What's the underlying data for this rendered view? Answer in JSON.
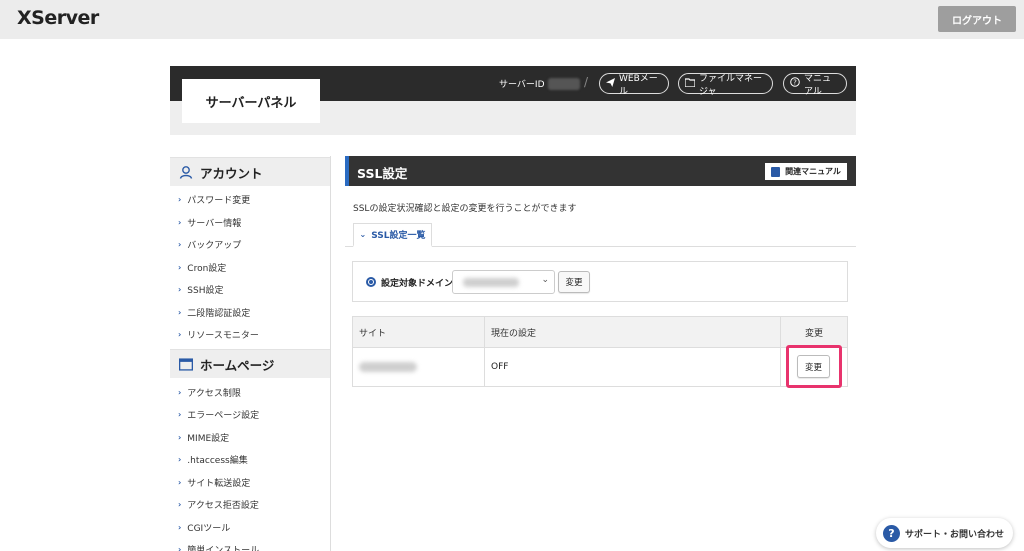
{
  "header": {
    "logo": "XServer",
    "logout_label": "ログアウト"
  },
  "panel": {
    "title": "サーバーパネル",
    "server_id_label": "サーバーID",
    "links": [
      {
        "icon": "send-icon",
        "label": "WEBメール"
      },
      {
        "icon": "folder-icon",
        "label": "ファイルマネージャ"
      },
      {
        "icon": "help-circle-icon",
        "label": "マニュアル"
      }
    ]
  },
  "sidebar": {
    "sections": [
      {
        "title": "アカウント",
        "icon": "user-icon",
        "items": [
          "パスワード変更",
          "サーバー情報",
          "バックアップ",
          "Cron設定",
          "SSH設定",
          "二段階認証設定",
          "リソースモニター"
        ]
      },
      {
        "title": "ホームページ",
        "icon": "window-icon",
        "items": [
          "アクセス制限",
          "エラーページ設定",
          "MIME設定",
          ".htaccess編集",
          "サイト転送設定",
          "アクセス拒否設定",
          "CGIツール",
          "簡単インストール"
        ]
      }
    ]
  },
  "main": {
    "title": "SSL設定",
    "manual_label": "関連マニュアル",
    "description": "SSLの設定状況確認と設定の変更を行うことができます",
    "tab_label": "SSL設定一覧",
    "domain_label": "設定対象ドメイン",
    "change_label": "変更",
    "table": {
      "headers": [
        "サイト",
        "現在の設定",
        "変更"
      ],
      "rows": [
        {
          "setting": "OFF",
          "action": "変更"
        }
      ]
    }
  },
  "support_label": "サポート・お問い合わせ",
  "colors": {
    "accent": "#2a5aa6",
    "highlight": "#e8336d",
    "dark_bar": "#2b2b2b"
  }
}
